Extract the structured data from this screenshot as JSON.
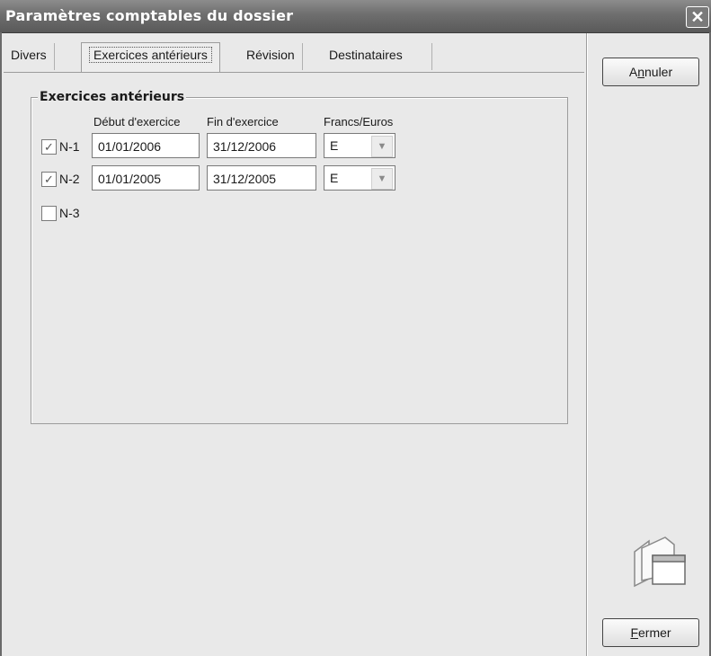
{
  "window": {
    "title": "Paramètres comptables du dossier",
    "close_glyph": "✕"
  },
  "tabs": [
    {
      "label": "Divers",
      "active": false
    },
    {
      "label": "Exercices antérieurs",
      "active": true
    },
    {
      "label": "Révision",
      "active": false
    },
    {
      "label": "Destinataires",
      "active": false
    }
  ],
  "group": {
    "title": "Exercices antérieurs",
    "columns": [
      "Début d'exercice",
      "Fin d'exercice",
      "Francs/Euros"
    ],
    "rows": [
      {
        "label": "N-1",
        "checked": true,
        "debut": "01/01/2006",
        "fin": "31/12/2006",
        "devise": "E"
      },
      {
        "label": "N-2",
        "checked": true,
        "debut": "01/01/2005",
        "fin": "31/12/2005",
        "devise": "E"
      },
      {
        "label": "N-3",
        "checked": false
      }
    ]
  },
  "buttons": {
    "annuler_pre": "A",
    "annuler_ul": "n",
    "annuler_post": "nuler",
    "fermer_ul": "F",
    "fermer_post": "ermer"
  },
  "icons": {
    "close": "close-icon",
    "folder": "folder-window-icon",
    "dropdown": "chevron-down-icon",
    "check": "check-icon"
  },
  "glyphs": {
    "check": "✓",
    "dropdown": "▼"
  }
}
